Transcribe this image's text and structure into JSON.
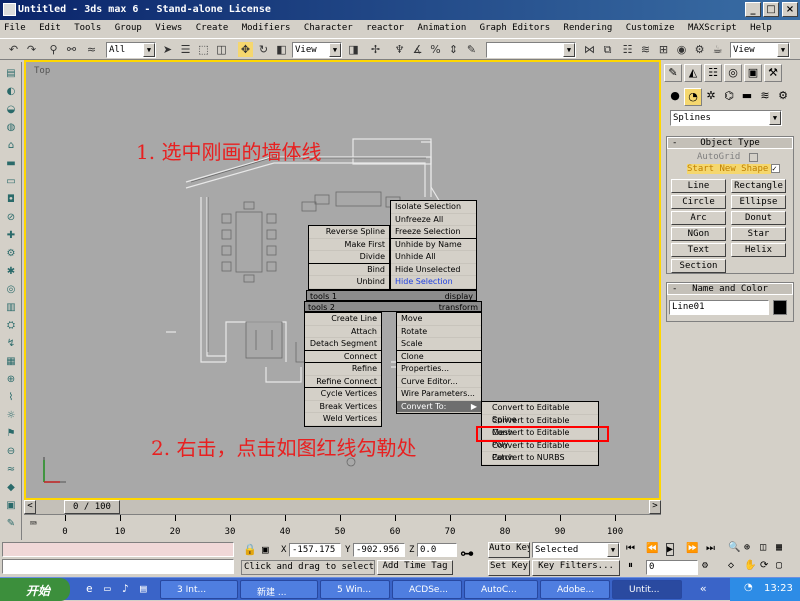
{
  "window": {
    "title": "Untitled - 3ds max 6 - Stand-alone License",
    "min": "_",
    "max": "□",
    "close": "×"
  },
  "menu": [
    "File",
    "Edit",
    "Tools",
    "Group",
    "Views",
    "Create",
    "Modifiers",
    "Character",
    "reactor",
    "Animation",
    "Graph Editors",
    "Rendering",
    "Customize",
    "MAXScript",
    "Help"
  ],
  "toolbar": {
    "selection_filter": "All",
    "ref_coord": "View",
    "named_sel": "",
    "right_view": "View"
  },
  "viewport": {
    "label": "Top"
  },
  "annotations": {
    "step1": "1. 选中刚画的墙体线",
    "step2": "2. 右击，点击如图红线勾勒处"
  },
  "quad_menu": {
    "top_left": [
      "Reverse Spline",
      "Make First",
      "Divide",
      "Bind",
      "Unbind"
    ],
    "top_right": [
      "Isolate Selection",
      "Unfreeze All",
      "Freeze Selection",
      "Unhide by Name",
      "Unhide All",
      "Hide Unselected",
      "Hide Selection"
    ],
    "bar_left_1": "tools 1",
    "bar_right_1": "display",
    "bar_left_2": "tools 2",
    "bar_right_2": "transform",
    "bottom_left": [
      "Create Line",
      "Attach",
      "Detach Segment",
      "Connect",
      "Refine",
      "Refine Connect",
      "Cycle Vertices",
      "Break Vertices",
      "Weld Vertices"
    ],
    "bottom_right": [
      "Move",
      "Rotate",
      "Scale",
      "Clone",
      "Properties...",
      "Curve Editor...",
      "Wire Parameters...",
      "Convert To:"
    ],
    "convert_sub": [
      "Convert to Editable Spline",
      "Convert to Editable Mesh",
      "Convert to Editable Poly",
      "Convert to Editable Patch",
      "Convert to NURBS"
    ]
  },
  "command_panel": {
    "category": "Splines",
    "object_type_title": "Object Type",
    "autogrid": "AutoGrid",
    "start_new_shape": "Start New Shape",
    "buttons": [
      "Line",
      "Rectangle",
      "Circle",
      "Ellipse",
      "Arc",
      "Donut",
      "NGon",
      "Star",
      "Text",
      "Helix",
      "Section"
    ],
    "name_color_title": "Name and Color",
    "object_name": "Line01",
    "object_color": "#000000"
  },
  "timeline": {
    "frame": "0 / 100",
    "ticks": [
      "0",
      "10",
      "20",
      "30",
      "40",
      "50",
      "60",
      "70",
      "80",
      "90",
      "100"
    ]
  },
  "status": {
    "x_label": "X",
    "x": "-157.175",
    "y_label": "Y",
    "y": "-902.956",
    "z_label": "Z",
    "z": "0.0",
    "prompt": "Click and drag to select",
    "add_time_tag": "Add Time Tag",
    "auto_key": "Auto Key",
    "set_key": "Set Key",
    "key_mode": "Selected",
    "key_filters": "Key Filters...",
    "frame": "0"
  },
  "taskbar": {
    "start": "开始",
    "tasks": [
      "3 Int...",
      "新建 ...",
      "5 Win...",
      "ACDSe...",
      "AutoC...",
      "Adobe...",
      "Untit..."
    ],
    "clock": "13:23"
  }
}
